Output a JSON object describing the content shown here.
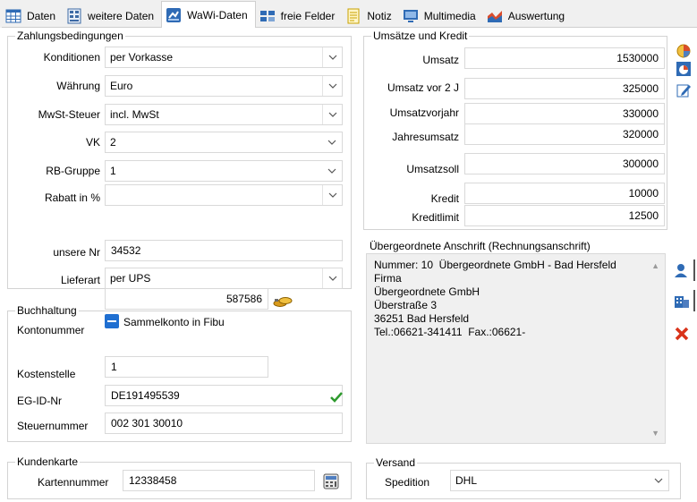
{
  "tabs": [
    {
      "label": "Daten",
      "icon": "table-icon"
    },
    {
      "label": "weitere Daten",
      "icon": "grid-icon"
    },
    {
      "label": "WaWi-Daten",
      "icon": "wawi-icon"
    },
    {
      "label": "freie Felder",
      "icon": "fields-icon"
    },
    {
      "label": "Notiz",
      "icon": "note-icon"
    },
    {
      "label": "Multimedia",
      "icon": "monitor-icon"
    },
    {
      "label": "Auswertung",
      "icon": "chart-icon"
    }
  ],
  "active_tab": "WaWi-Daten",
  "zahlung": {
    "title": "Zahlungsbedingungen",
    "konditionen_label": "Konditionen",
    "konditionen_value": "per Vorkasse",
    "waehrung_label": "Währung",
    "waehrung_value": "Euro",
    "mwst_label": "MwSt-Steuer",
    "mwst_value": "incl. MwSt",
    "vk_label": "VK",
    "vk_value": "2",
    "rbgruppe_label": "RB-Gruppe",
    "rbgruppe_value": "1",
    "rabatt_label": "Rabatt in %",
    "rabatt_value": "",
    "unsere_nr_label": "unsere Nr",
    "unsere_nr_value": "34532",
    "lieferart_label": "Lieferart",
    "lieferart_value": "per UPS"
  },
  "buchhaltung": {
    "title": "Buchhaltung",
    "kontonummer_label": "Kontonummer",
    "kontonummer_value": "587586",
    "sammelkonto_label": "Sammelkonto in Fibu",
    "kostenstelle_label": "Kostenstelle",
    "kostenstelle_value": "1",
    "egid_label": "EG-ID-Nr",
    "egid_value": "DE191495539",
    "steuernummer_label": "Steuernummer",
    "steuernummer_value": "002 301 30010"
  },
  "kundenkarte": {
    "title": "Kundenkarte",
    "kartennummer_label": "Kartennummer",
    "kartennummer_value": "12338458"
  },
  "umsaetze": {
    "title": "Umsätze und Kredit",
    "umsatz_label": "Umsatz",
    "umsatz_value": "1530000",
    "umsatz_vor2_label": "Umsatz vor 2 J",
    "umsatz_vor2_value": "325000",
    "umsatzvorjahr_label": "Umsatzvorjahr",
    "umsatzvorjahr_value": "330000",
    "jahresumsatz_label": "Jahresumsatz",
    "jahresumsatz_value": "320000",
    "umsatzsoll_label": "Umsatzsoll",
    "umsatzsoll_value": "300000",
    "kredit_label": "Kredit",
    "kredit_value": "10000",
    "kreditlimit_label": "Kreditlimit",
    "kreditlimit_value": "12500"
  },
  "anschrift": {
    "title": "Übergeordnete Anschrift (Rechnungsanschrift)",
    "text": "Nummer: 10  Übergeordnete GmbH - Bad Hersfeld\nFirma\nÜbergeordnete GmbH\nÜberstraße 3\n36251 Bad Hersfeld\nTel.:06621-341411  Fax.:06621-"
  },
  "versand": {
    "title": "Versand",
    "spedition_label": "Spedition",
    "spedition_value": "DHL"
  },
  "colors": {
    "accent_blue": "#1f6fd1",
    "check_green": "#2e9a2e",
    "delete_red": "#d9331a"
  }
}
